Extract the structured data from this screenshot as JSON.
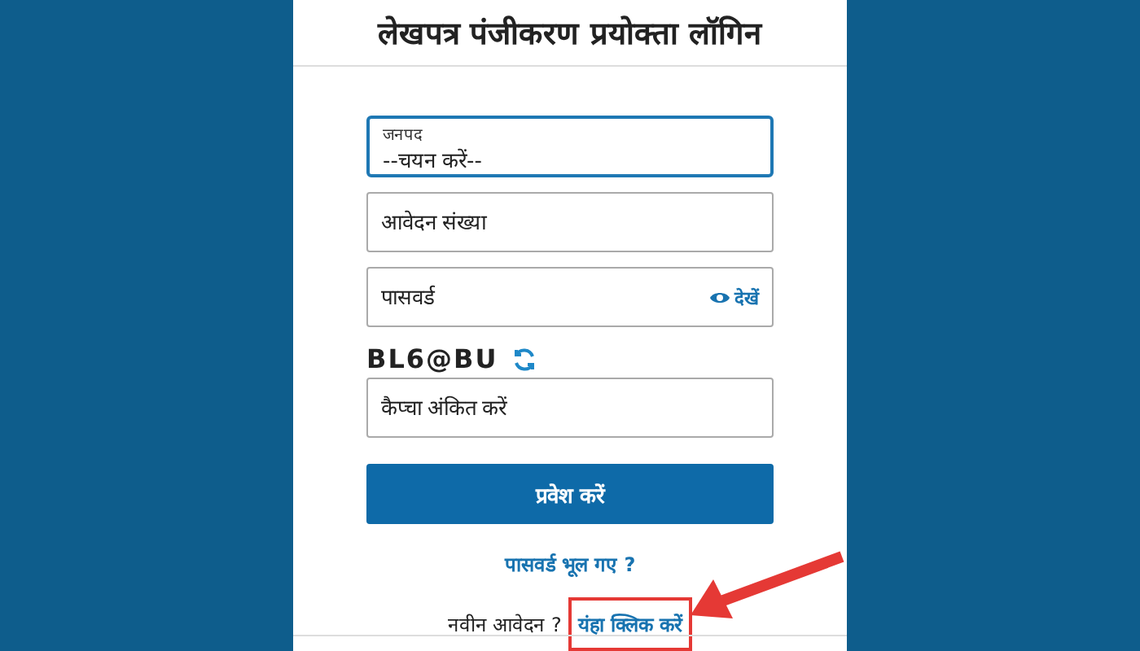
{
  "title": "लेखपत्र पंजीकरण प्रयोक्ता लॉगिन",
  "district": {
    "label": "जनपद",
    "value": "--चयन करें--"
  },
  "fields": [
    {
      "placeholder": "आवेदन संख्या"
    },
    {
      "placeholder": "पासवर्ड",
      "toggle": "देखें"
    }
  ],
  "captcha": {
    "code": "BL6@BU",
    "placeholder": "कैप्चा अंकित करें"
  },
  "submit": "प्रवेश करें",
  "forgot_link": "पासवर्ड भूल गए ?",
  "new_application": {
    "text": "नवीन आवेदन ?",
    "link": "यंहा क्लिक करें",
    "highlighted": true
  }
}
